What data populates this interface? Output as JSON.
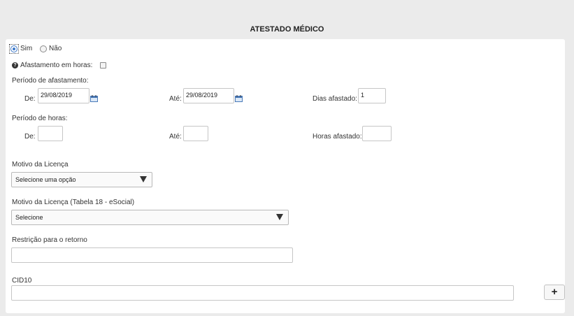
{
  "header": {
    "title": "ATESTADO MÉDICO"
  },
  "radio": {
    "sim": "Sim",
    "nao": "Não"
  },
  "afastamento_horas": {
    "label": "Afastamento em horas:"
  },
  "periodo_afastamento": {
    "label": "Período de afastamento:",
    "de_label": "De:",
    "de_value": "29/08/2019",
    "ate_label": "Até:",
    "ate_value": "29/08/2019",
    "dias_label": "Dias afastado:",
    "dias_value": "1"
  },
  "periodo_horas": {
    "label": "Período de horas:",
    "de_label": "De:",
    "de_value": "",
    "ate_label": "Até:",
    "ate_value": "",
    "horas_label": "Horas afastado:",
    "horas_value": ""
  },
  "motivo_licenca": {
    "label": "Motivo da Licença",
    "selected": "Selecione uma opção"
  },
  "motivo_esocial": {
    "label": "Motivo da Licença (Tabela 18 - eSocial)",
    "selected": "Selecione"
  },
  "restricao": {
    "label": "Restrição para o retorno",
    "value": ""
  },
  "cid10": {
    "label": "CID10",
    "value": "",
    "add_label": "+"
  }
}
